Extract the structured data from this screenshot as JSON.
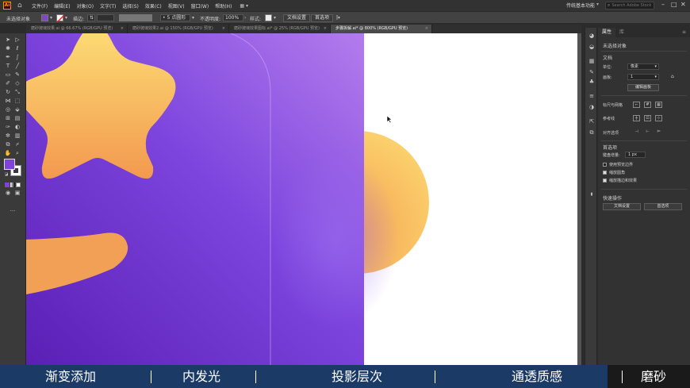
{
  "app": {
    "logo": "Ai",
    "menus": [
      "文件(F)",
      "编辑(E)",
      "对象(O)",
      "文字(T)",
      "选择(S)",
      "效果(C)",
      "视图(V)",
      "窗口(W)",
      "帮助(H)"
    ],
    "workspace": "传统基本功能",
    "search_placeholder": "Search Adobe Stock"
  },
  "control_bar": {
    "selection_label": "未选择对象",
    "stroke_label": "描边:",
    "stroke_preset": "5 点圆形",
    "opacity_label": "不透明度:",
    "opacity_value": "100%",
    "style_label": "样式:",
    "doc_setup_button": "文档设置",
    "preferences_button": "首选项"
  },
  "tabs": [
    {
      "label": "磨砂玻璃效果.ai @ 66.67% (RGB/GPU 预览)",
      "active": false
    },
    {
      "label": "磨砂玻璃效果2.ai @ 150% (RGB/GPU 预览)",
      "active": false
    },
    {
      "label": "磨砂玻璃效果图标.ai* @ 25% (RGB/GPU 预览)",
      "active": false
    },
    {
      "label": "步骤拆解.ai* @ 800% (RGB/GPU 预览)",
      "active": true
    }
  ],
  "properties_panel": {
    "tab_properties": "属性",
    "tab_library": "库",
    "no_selection": "未选择对象",
    "document_label": "文档",
    "units_label": "单位:",
    "units_value": "像素",
    "artboard_label": "画板:",
    "artboard_value": "1",
    "edit_artboards_button": "编辑画板",
    "rulers_grid_label": "标尺与网格",
    "guides_label": "参考线",
    "snap_label": "对齐选项",
    "preferences_label": "首选项",
    "keyboard_increment_label": "键盘增量:",
    "keyboard_increment_value": "1 px",
    "use_preview_bounds": "使用预览边界",
    "scale_corners": "缩放圆角",
    "scale_strokes_effects": "缩放描边和效果",
    "quick_actions_label": "快速操作",
    "doc_setup_button": "文档设置",
    "preferences_button": "首选项"
  },
  "checkboxes": {
    "use_preview_bounds": false,
    "scale_corners": true,
    "scale_strokes_effects": true
  },
  "subtitle_bar": {
    "items": [
      "渐变添加",
      "内发光",
      "投影层次",
      "通透质感",
      "磨砂"
    ],
    "active_index": 4
  },
  "colors": {
    "fill": "#7f43d8",
    "purple_dark": "#5b21b6",
    "purple_light": "#a368e6",
    "orange": "#f5a65b",
    "yellow": "#fcd973",
    "subtitle_bg": "#1b3a66"
  }
}
